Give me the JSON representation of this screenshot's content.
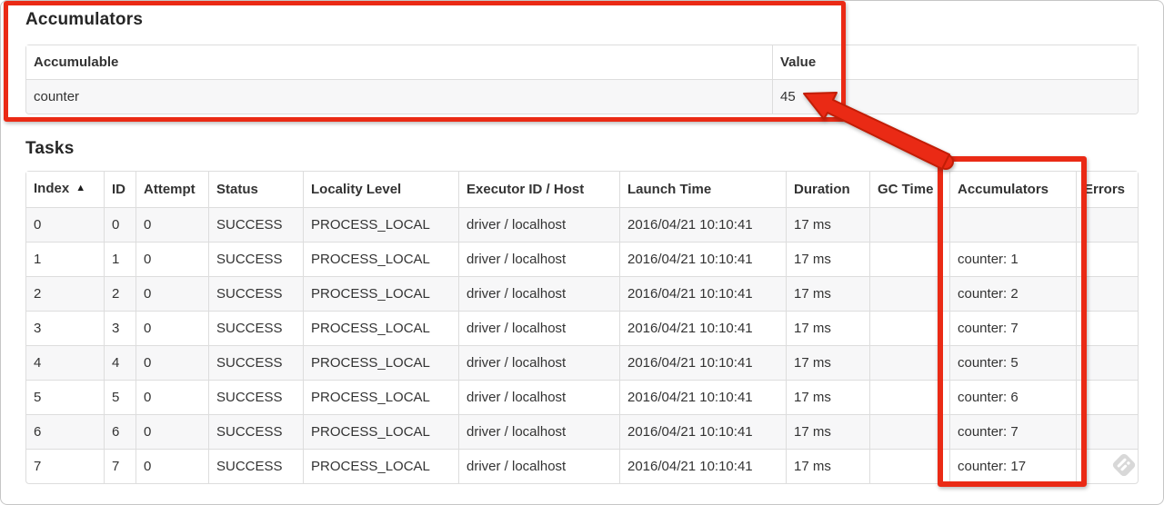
{
  "colors": {
    "annotation_red": "#ea2a15",
    "annotation_red_dark": "#c21d06",
    "table_border": "#dddddd",
    "stripe_bg": "#f7f7f8",
    "text": "#333333"
  },
  "accumulators": {
    "title": "Accumulators",
    "headers": [
      "Accumulable",
      "Value"
    ],
    "rows": [
      [
        "counter",
        "45"
      ]
    ]
  },
  "tasks": {
    "title": "Tasks",
    "sort_icon": "▲",
    "headers": [
      "Index",
      "ID",
      "Attempt",
      "Status",
      "Locality Level",
      "Executor ID / Host",
      "Launch Time",
      "Duration",
      "GC Time",
      "Accumulators",
      "Errors"
    ],
    "rows": [
      [
        "0",
        "0",
        "0",
        "SUCCESS",
        "PROCESS_LOCAL",
        "driver / localhost",
        "2016/04/21 10:10:41",
        "17 ms",
        "",
        "",
        ""
      ],
      [
        "1",
        "1",
        "0",
        "SUCCESS",
        "PROCESS_LOCAL",
        "driver / localhost",
        "2016/04/21 10:10:41",
        "17 ms",
        "",
        "counter: 1",
        ""
      ],
      [
        "2",
        "2",
        "0",
        "SUCCESS",
        "PROCESS_LOCAL",
        "driver / localhost",
        "2016/04/21 10:10:41",
        "17 ms",
        "",
        "counter: 2",
        ""
      ],
      [
        "3",
        "3",
        "0",
        "SUCCESS",
        "PROCESS_LOCAL",
        "driver / localhost",
        "2016/04/21 10:10:41",
        "17 ms",
        "",
        "counter: 7",
        ""
      ],
      [
        "4",
        "4",
        "0",
        "SUCCESS",
        "PROCESS_LOCAL",
        "driver / localhost",
        "2016/04/21 10:10:41",
        "17 ms",
        "",
        "counter: 5",
        ""
      ],
      [
        "5",
        "5",
        "0",
        "SUCCESS",
        "PROCESS_LOCAL",
        "driver / localhost",
        "2016/04/21 10:10:41",
        "17 ms",
        "",
        "counter: 6",
        ""
      ],
      [
        "6",
        "6",
        "0",
        "SUCCESS",
        "PROCESS_LOCAL",
        "driver / localhost",
        "2016/04/21 10:10:41",
        "17 ms",
        "",
        "counter: 7",
        ""
      ],
      [
        "7",
        "7",
        "0",
        "SUCCESS",
        "PROCESS_LOCAL",
        "driver / localhost",
        "2016/04/21 10:10:41",
        "17 ms",
        "",
        "counter: 17",
        ""
      ]
    ]
  }
}
